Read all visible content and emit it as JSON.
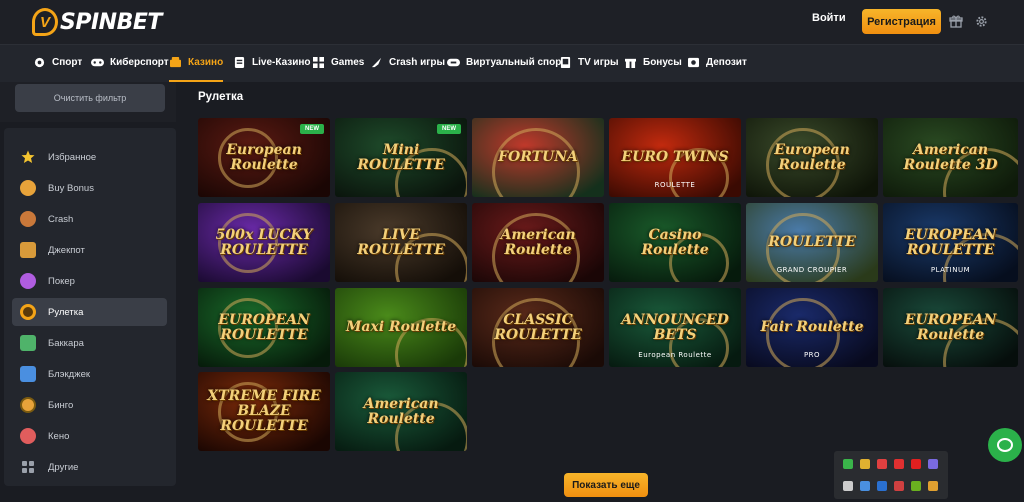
{
  "header": {
    "logo_text": "SPINBET",
    "logo_mark": "V",
    "login_label": "Войти",
    "register_label": "Регистрация",
    "icons": [
      "gift-icon",
      "gear-icon"
    ]
  },
  "nav": {
    "items": [
      {
        "label": "Спорт",
        "icon": "sport-icon"
      },
      {
        "label": "Киберспорт",
        "icon": "gamepad-icon"
      },
      {
        "label": "Казино",
        "icon": "casino-icon",
        "active": true
      },
      {
        "label": "Live-Казино",
        "icon": "live-icon"
      },
      {
        "label": "Games",
        "icon": "games-icon"
      },
      {
        "label": "Crash игры",
        "icon": "rocket-icon"
      },
      {
        "label": "Виртуальный спорт",
        "icon": "virtual-icon"
      },
      {
        "label": "TV игры",
        "icon": "tv-icon"
      },
      {
        "label": "Бонусы",
        "icon": "gift-icon"
      },
      {
        "label": "Депозит",
        "icon": "wallet-icon"
      }
    ]
  },
  "sidebar": {
    "clear_filter_label": "Очистить фильтр",
    "items": [
      {
        "label": "Избранное",
        "icon": "star-icon",
        "color": "#f4c430"
      },
      {
        "label": "Buy Bonus",
        "icon": "coins-icon",
        "color": "#e8a33a"
      },
      {
        "label": "Crash",
        "icon": "crash-icon",
        "color": "#e8a33a"
      },
      {
        "label": "Джекпот",
        "icon": "jackpot-icon",
        "color": "#e8a33a"
      },
      {
        "label": "Покер",
        "icon": "poker-icon",
        "color": "#b05de0"
      },
      {
        "label": "Рулетка",
        "icon": "roulette-icon",
        "color": "#f4a417",
        "active": true
      },
      {
        "label": "Баккара",
        "icon": "baccarat-icon",
        "color": "#4fb36a"
      },
      {
        "label": "Блэкджек",
        "icon": "blackjack-icon",
        "color": "#4a8fe0"
      },
      {
        "label": "Бинго",
        "icon": "bingo-icon",
        "color": "#e8a33a"
      },
      {
        "label": "Кено",
        "icon": "keno-icon",
        "color": "#e05d5d"
      },
      {
        "label": "Другие",
        "icon": "grid-icon",
        "color": "#9aa0aa"
      }
    ]
  },
  "main": {
    "section_title": "Рулетка",
    "show_more_label": "Показать еще",
    "games": [
      {
        "title": "European Roulette",
        "sub": "",
        "badge": "NEW",
        "bg": "#5a1a12",
        "bg2": "#1a0604"
      },
      {
        "title": "Mini ROULETTE",
        "sub": "",
        "badge": "NEW",
        "bg": "#1e4a2a",
        "bg2": "#0a140c"
      },
      {
        "title": "FORTUNA",
        "sub": "",
        "badge": "",
        "bg": "#c0392b",
        "bg2": "#14301c"
      },
      {
        "title": "EURO TWINS",
        "sub": "ROULETTE",
        "badge": "",
        "bg": "#c22a0e",
        "bg2": "#3a0a02"
      },
      {
        "title": "European Roulette",
        "sub": "",
        "badge": "",
        "bg": "#3a4a2a",
        "bg2": "#0e1408"
      },
      {
        "title": "American Roulette 3D",
        "sub": "",
        "badge": "",
        "bg": "#2a4a22",
        "bg2": "#0e1a0a"
      },
      {
        "title": "500x LUCKY ROULETTE",
        "sub": "",
        "badge": "",
        "bg": "#6a2aa8",
        "bg2": "#1a0a30"
      },
      {
        "title": "LIVE ROULETTE",
        "sub": "",
        "badge": "",
        "bg": "#4a3a2a",
        "bg2": "#140e08"
      },
      {
        "title": "American Roulette",
        "sub": "",
        "badge": "",
        "bg": "#6a1a1a",
        "bg2": "#1a0606"
      },
      {
        "title": "Casino Roulette",
        "sub": "",
        "badge": "",
        "bg": "#1a5a2a",
        "bg2": "#061a0c"
      },
      {
        "title": "ROULETTE",
        "sub": "GRAND CROUPIER",
        "badge": "",
        "bg": "#4a7aa8",
        "bg2": "#2a3a1a"
      },
      {
        "title": "EUROPEAN ROULETTE",
        "sub": "PLATINUM",
        "badge": "",
        "bg": "#1a3a6a",
        "bg2": "#060e1e"
      },
      {
        "title": "EUROPEAN ROULETTE",
        "sub": "",
        "badge": "",
        "bg": "#1a6a2a",
        "bg2": "#061a0a"
      },
      {
        "title": "Maxi Roulette",
        "sub": "",
        "badge": "",
        "bg": "#4a8a1a",
        "bg2": "#1a3a08"
      },
      {
        "title": "CLASSIC ROULETTE",
        "sub": "",
        "badge": "",
        "bg": "#5a2a1a",
        "bg2": "#1a0a06"
      },
      {
        "title": "ANNOUNCED BETS",
        "sub": "European Roulette",
        "badge": "",
        "bg": "#1a5a3a",
        "bg2": "#061a10"
      },
      {
        "title": "Fair Roulette",
        "sub": "PRO",
        "badge": "",
        "bg": "#1a2a6a",
        "bg2": "#080a1e"
      },
      {
        "title": "EUROPEAN Roulette",
        "sub": "",
        "badge": "",
        "bg": "#1a4a3a",
        "bg2": "#060e0c"
      },
      {
        "title": "XTREME FIRE BLAZE ROULETTE",
        "sub": "",
        "badge": "",
        "bg": "#7a2a0a",
        "bg2": "#1a0602"
      },
      {
        "title": "American Roulette",
        "sub": "",
        "badge": "",
        "bg": "#1a5a3a",
        "bg2": "#061a10"
      }
    ]
  },
  "tray": {
    "icons": [
      {
        "name": "shield-tray-icon",
        "color": "#3ab54a"
      },
      {
        "name": "chrome-tray-icon",
        "color": "#e0b030"
      },
      {
        "name": "app-tray-icon",
        "color": "#e04040"
      },
      {
        "name": "red-tray-icon",
        "color": "#e03030"
      },
      {
        "name": "youtube-tray-icon",
        "color": "#e02020"
      },
      {
        "name": "pen-tray-icon",
        "color": "#7a6ae0"
      },
      {
        "name": "usb-tray-icon",
        "color": "#cccccc"
      },
      {
        "name": "network-tray-icon",
        "color": "#4a90e0"
      },
      {
        "name": "bluetooth-tray-icon",
        "color": "#2a70d0"
      },
      {
        "name": "app2-tray-icon",
        "color": "#d04040"
      },
      {
        "name": "nvidia-tray-icon",
        "color": "#6ab020"
      },
      {
        "name": "volume-tray-icon",
        "color": "#e0a030"
      }
    ]
  }
}
